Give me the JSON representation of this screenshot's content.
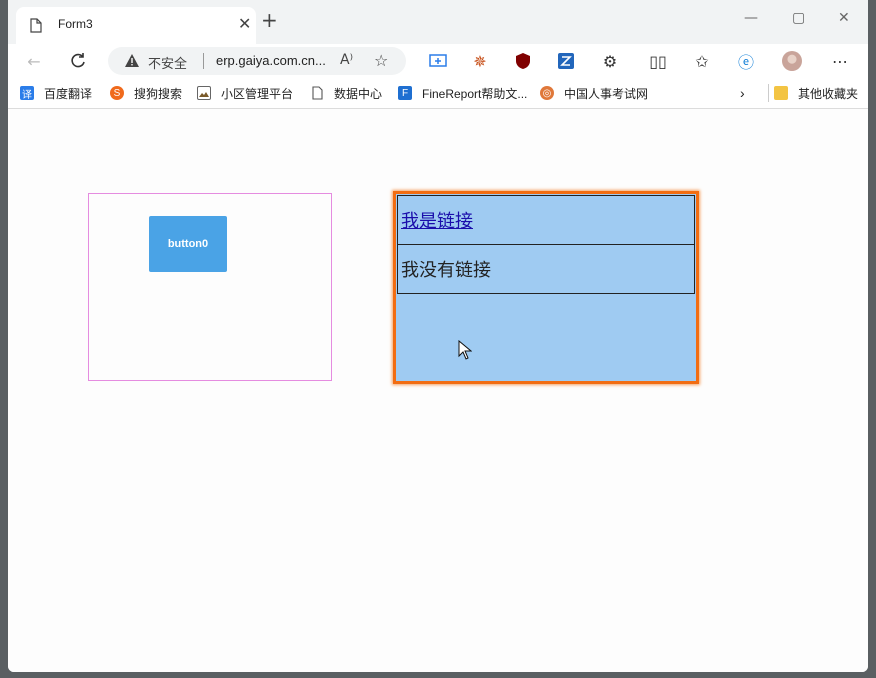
{
  "tab": {
    "title": "Form3"
  },
  "address": {
    "security_label": "不安全",
    "url": "erp.gaiya.com.cn..."
  },
  "bookmarks": [
    {
      "label": "百度翻译",
      "icon": "translate-icon",
      "color": "#2b7de9"
    },
    {
      "label": "搜狗搜索",
      "icon": "sogou-icon",
      "color": "#f06a1c"
    },
    {
      "label": "小区管理平台",
      "icon": "image-icon",
      "color": "#666666"
    },
    {
      "label": "数据中心",
      "icon": "page-icon",
      "color": "#666666"
    },
    {
      "label": "FineReport帮助文...",
      "icon": "finereport-icon",
      "color": "#1f6fd1"
    },
    {
      "label": "中国人事考试网",
      "icon": "exam-icon",
      "color": "#e0783a"
    }
  ],
  "other_bookmarks": "其他收藏夹",
  "form": {
    "button_label": "button0",
    "link_row": "我是链接",
    "plain_row": "我没有链接"
  },
  "colors": {
    "accent_border": "#f26d12",
    "panel_fill": "#9fcbf2",
    "button_fill": "#4aa3e6",
    "left_panel_border": "#e58ce0"
  }
}
